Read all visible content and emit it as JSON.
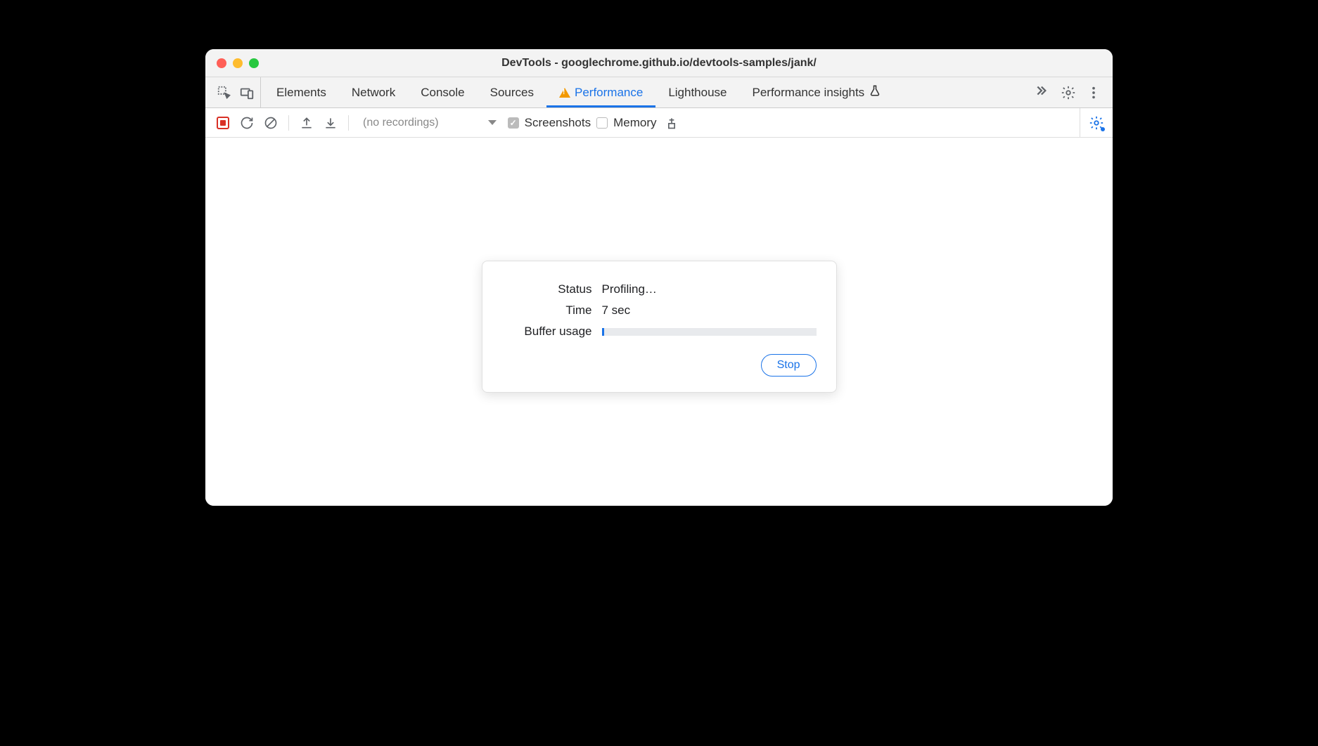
{
  "window": {
    "title": "DevTools - googlechrome.github.io/devtools-samples/jank/"
  },
  "tabs": {
    "items": [
      "Elements",
      "Network",
      "Console",
      "Sources",
      "Performance",
      "Lighthouse",
      "Performance insights"
    ],
    "active_index": 4,
    "warning_on_index": 4
  },
  "toolbar": {
    "recordings_placeholder": "(no recordings)",
    "screenshots": {
      "label": "Screenshots",
      "checked": true
    },
    "memory": {
      "label": "Memory",
      "checked": false
    }
  },
  "dialog": {
    "status_label": "Status",
    "status_value": "Profiling…",
    "time_label": "Time",
    "time_value": "7 sec",
    "buffer_label": "Buffer usage",
    "buffer_percent": 1,
    "stop_label": "Stop"
  }
}
